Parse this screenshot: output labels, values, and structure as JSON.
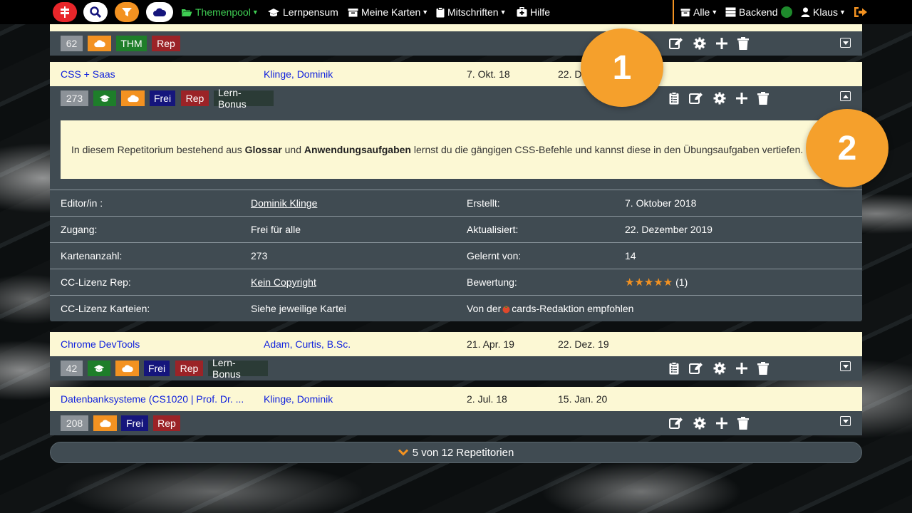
{
  "navbar": {
    "themenpool": "Themenpool",
    "lernpensum": "Lernpensum",
    "meine_karten": "Meine Karten",
    "mitschriften": "Mitschriften",
    "hilfe": "Hilfe",
    "alle": "Alle",
    "backend": "Backend",
    "user": "Klaus",
    "colors": {
      "red": "#e8262a",
      "orange": "#f39221",
      "green_active": "#3fcf53"
    }
  },
  "top_partial_card": {
    "badges": {
      "count": "62",
      "thm": "THM",
      "rep": "Rep"
    }
  },
  "cards": [
    {
      "title": "CSS + Saas",
      "author": "Klinge, Dominik",
      "created": "7. Okt. 18",
      "updated": "22. De",
      "badges": {
        "count": "273",
        "frei": "Frei",
        "rep": "Rep",
        "lern_bonus": "Lern-Bonus"
      },
      "description": {
        "part1": "In diesem Repetitorium bestehend aus ",
        "bold1": "Glossar",
        "part2": " und ",
        "bold2": "Anwendungsaufgaben",
        "part3": " lernst du die gängigen CSS-Befehle und kannst diese in den Übungsaufgaben vertiefen."
      },
      "details": {
        "editor_label": "Editor/in :",
        "editor_value": "Dominik Klinge",
        "created_label": "Erstellt:",
        "created_value": "7. Oktober 2018",
        "access_label": "Zugang:",
        "access_value": "Frei für alle",
        "updated_label": "Aktualisiert:",
        "updated_value": "22. Dezember 2019",
        "cards_label": "Kartenanzahl:",
        "cards_value": "273",
        "learned_label": "Gelernt von:",
        "learned_value": "14",
        "cc_rep_label": "CC-Lizenz Rep:",
        "cc_rep_value": "Kein Copyright",
        "rating_label": "Bewertung:",
        "rating_stars": "★★★★★",
        "rating_count": "(1)",
        "cc_kart_label": "CC-Lizenz Karteien:",
        "cc_kart_value": "Siehe jeweilige Kartei",
        "recommended_prefix": "Von der ",
        "recommended_suffix": "cards-Redaktion empfohlen"
      }
    },
    {
      "title": "Chrome DevTools",
      "author": "Adam, Curtis, B.Sc.",
      "created": "21. Apr. 19",
      "updated": "22. Dez. 19",
      "badges": {
        "count": "42",
        "frei": "Frei",
        "rep": "Rep",
        "lern_bonus": "Lern-Bonus"
      }
    },
    {
      "title": "Datenbanksysteme (CS1020 | Prof. Dr. ...",
      "author": "Klinge, Dominik",
      "created": "2. Jul. 18",
      "updated": "15. Jan. 20",
      "badges": {
        "count": "208",
        "frei": "Frei",
        "rep": "Rep"
      }
    }
  ],
  "footer": {
    "text": "5 von 12 Repetitorien"
  },
  "markers": {
    "one": "1",
    "two": "2"
  }
}
